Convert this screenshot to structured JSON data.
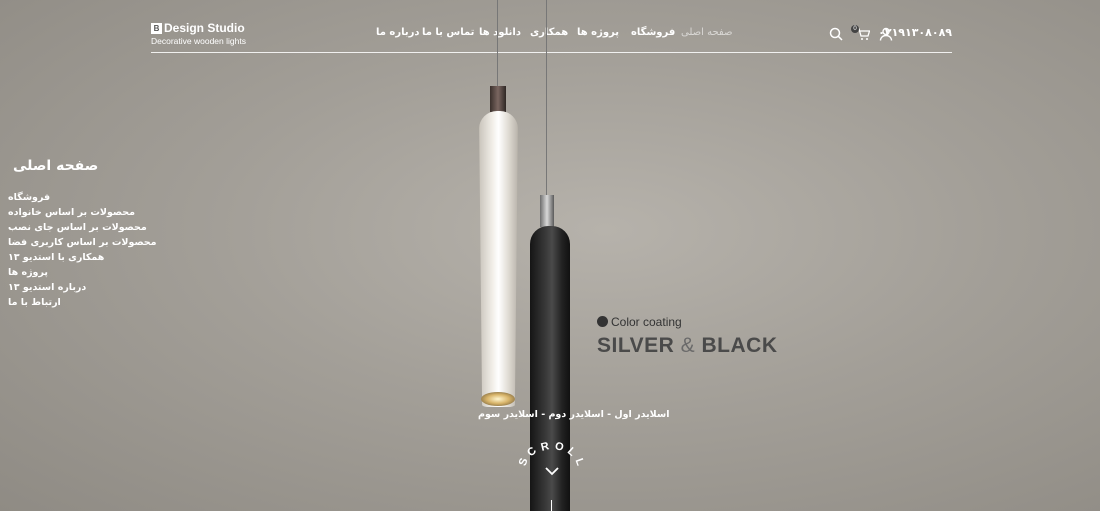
{
  "logo": {
    "mark": "B",
    "name": "Design Studio",
    "tagline": "Decorative wooden lights"
  },
  "nav": [
    {
      "label": "صفحه اصلی",
      "active": true
    },
    {
      "label": "فروشگاه"
    },
    {
      "label": "پروژه ها"
    },
    {
      "label": "همکاری"
    },
    {
      "label": "دانلود ها"
    },
    {
      "label": "تماس با ما"
    },
    {
      "label": "درباره ما"
    }
  ],
  "header": {
    "phone": "۰۲۱۹۱۳۰۸۰۸۹",
    "cart_count": "0"
  },
  "side_menu": {
    "title": "صفحه اصلی",
    "items": [
      "فروشگاه",
      "محصولات بر اساس خانواده",
      "محصولات بر اساس جای نصب",
      "محصولات بر اساس کاربری فضا",
      "همکاری با استدیو ۱۳",
      "پروژه ها",
      "درباره استدیو ۱۳",
      "ارتباط با ما"
    ]
  },
  "hero": {
    "coating_label": "Color coating",
    "headline_left": "SILVER",
    "headline_amp": "&",
    "headline_right": "BLACK",
    "slides_text": "اسلایدر اول - اسلایدر دوم - اسلایدر سوم",
    "scroll_label": "SCROLL"
  },
  "colors": {
    "text": "#ffffff",
    "headline": "#4a4a4a",
    "background": "#a39f98"
  }
}
